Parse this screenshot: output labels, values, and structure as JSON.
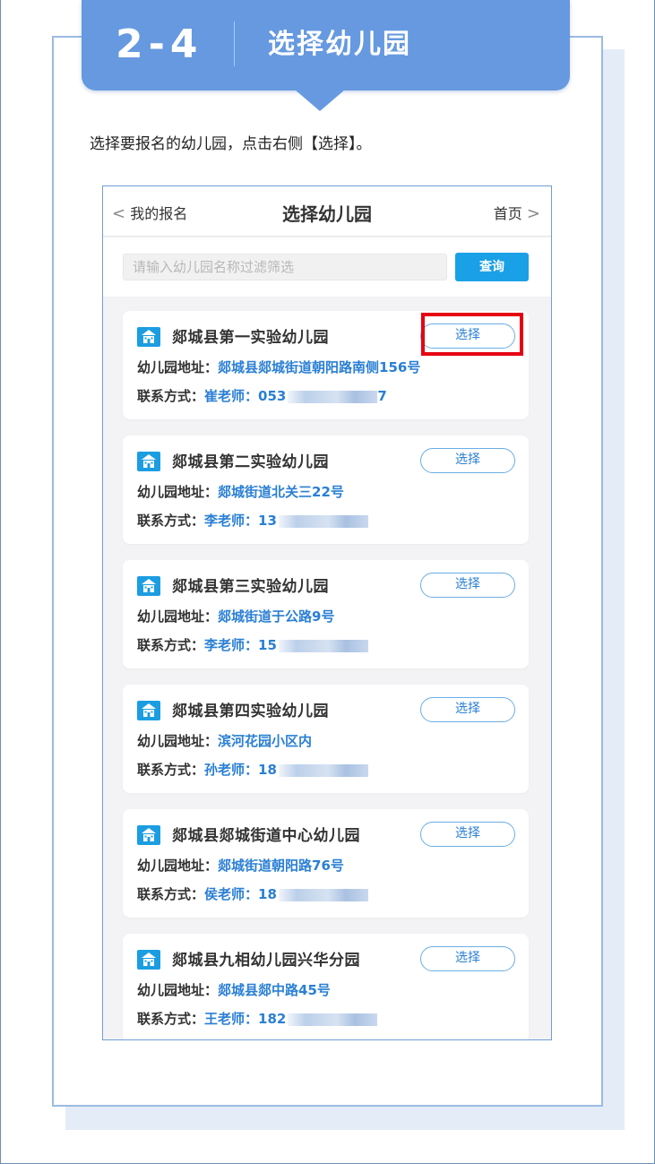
{
  "step": {
    "number": "2-4",
    "title": "选择幼儿园"
  },
  "instruction": "选择要报名的幼儿园，点击右侧【选择】。",
  "nav": {
    "back_chevron": "<",
    "back_label": "我的报名",
    "title": "选择幼儿园",
    "home_label": "首页",
    "home_chevron": ">"
  },
  "search": {
    "placeholder": "请输入幼儿园名称过滤筛选",
    "button_label": "查询"
  },
  "labels": {
    "address": "幼儿园地址：",
    "contact": "联系方式：",
    "select": "选择"
  },
  "kindergartens": [
    {
      "name": "郯城县第一实验幼儿园",
      "address": "郯城县郯城街道朝阳路南侧156号",
      "contact_name": "崔老师：",
      "phone_visible": "053",
      "phone_tail": "7"
    },
    {
      "name": "郯城县第二实验幼儿园",
      "address": "郯城街道北关三22号",
      "contact_name": "李老师：",
      "phone_visible": "13",
      "phone_tail": ""
    },
    {
      "name": "郯城县第三实验幼儿园",
      "address": "郯城街道于公路9号",
      "contact_name": "李老师：",
      "phone_visible": "15",
      "phone_tail": ""
    },
    {
      "name": "郯城县第四实验幼儿园",
      "address": "滨河花园小区内",
      "contact_name": "孙老师：",
      "phone_visible": "18",
      "phone_tail": ""
    },
    {
      "name": "郯城县郯城街道中心幼儿园",
      "address": "郯城街道朝阳路76号",
      "contact_name": "侯老师：",
      "phone_visible": "18",
      "phone_tail": ""
    },
    {
      "name": "郯城县九相幼儿园兴华分园",
      "address": "郯城县郯中路45号",
      "contact_name": "王老师：",
      "phone_visible": "182",
      "phone_tail": ""
    }
  ],
  "colors": {
    "banner": "#6699e0",
    "accent_blue": "#2a7fd4",
    "search_button": "#1aa0e6",
    "highlight": "#e60012"
  },
  "icons": {
    "school": "school-building-icon",
    "back": "chevron-left-icon",
    "home": "chevron-right-icon"
  }
}
